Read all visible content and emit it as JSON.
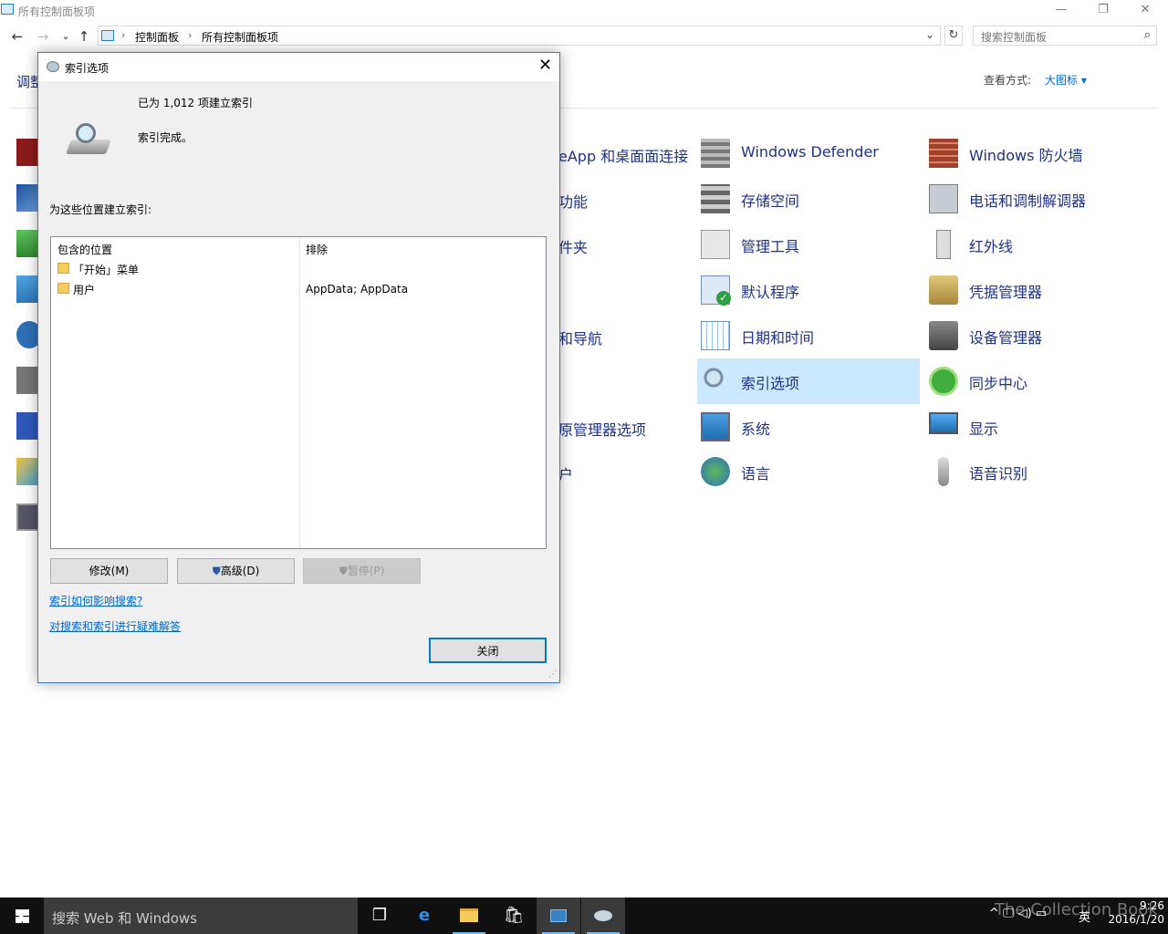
{
  "window": {
    "title": "所有控制面板项",
    "minimize": "—",
    "maximize": "❐",
    "close": "✕"
  },
  "nav": {
    "back": "←",
    "forward": "→",
    "recent": "⌄",
    "up": "↑",
    "breadcrumb": [
      "控制面板",
      "所有控制面板项"
    ],
    "refresh": "↻",
    "search_placeholder": "搜索控制面板"
  },
  "content": {
    "adjust_label": "调整",
    "view_by_label": "查看方式:",
    "view_by_value": "大图标 ▾"
  },
  "partial_items": [
    "eApp 和桌面面连接",
    "功能",
    "件夹",
    "和导航",
    "原管理器选项",
    "户"
  ],
  "column3": [
    {
      "label": "Windows Defender",
      "icon": "defender-wall-icon"
    },
    {
      "label": "存储空间",
      "icon": "storage-spaces-icon"
    },
    {
      "label": "管理工具",
      "icon": "admin-tools-icon"
    },
    {
      "label": "默认程序",
      "icon": "default-programs-icon"
    },
    {
      "label": "日期和时间",
      "icon": "date-time-icon"
    },
    {
      "label": "索引选项",
      "icon": "indexing-options-icon",
      "selected": true
    },
    {
      "label": "系统",
      "icon": "system-icon"
    },
    {
      "label": "语言",
      "icon": "language-icon"
    }
  ],
  "column4": [
    {
      "label": "Windows 防火墙",
      "icon": "firewall-icon"
    },
    {
      "label": "电话和调制解调器",
      "icon": "phone-modem-icon"
    },
    {
      "label": "红外线",
      "icon": "infrared-icon"
    },
    {
      "label": "凭据管理器",
      "icon": "credential-manager-icon"
    },
    {
      "label": "设备管理器",
      "icon": "device-manager-icon"
    },
    {
      "label": "同步中心",
      "icon": "sync-center-icon"
    },
    {
      "label": "显示",
      "icon": "display-icon"
    },
    {
      "label": "语音识别",
      "icon": "speech-recognition-icon"
    }
  ],
  "dialog": {
    "title": "索引选项",
    "close": "✕",
    "count_text": "已为 1,012 项建立索引",
    "status_text": "索引完成。",
    "locations_label": "为这些位置建立索引:",
    "col_included": "包含的位置",
    "col_excluded": "排除",
    "rows": [
      {
        "location": "「开始」菜单",
        "exclude": ""
      },
      {
        "location": "用户",
        "exclude": "AppData; AppData"
      }
    ],
    "modify_button": "修改(M)",
    "advanced_button": "高级(D)",
    "pause_button": "暂停(P)",
    "link_how": "索引如何影响搜索?",
    "link_troubleshoot": "对搜索和索引进行疑难解答",
    "close_button": "关闭"
  },
  "taskbar": {
    "search_placeholder": "搜索 Web 和 Windows",
    "time": "9:26",
    "date": "2016/1/20",
    "ime": "英",
    "tray": "^ 🖵 ◁) ▭",
    "watermark": "The Collection Book"
  },
  "colors": {
    "link": "#1e3287",
    "selection": "#cce8ff",
    "dialog_border": "#3a7fc2",
    "taskbar": "#101010"
  }
}
